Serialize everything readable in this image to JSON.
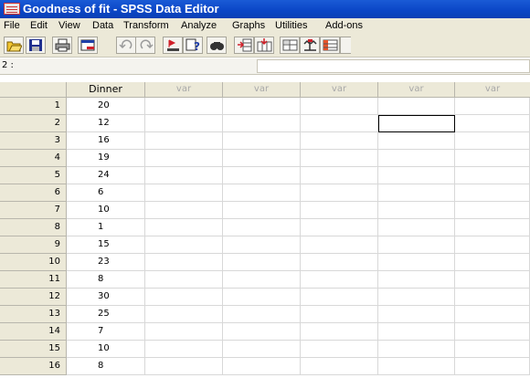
{
  "window": {
    "title": "Goodness of fit - SPSS Data Editor"
  },
  "menu": [
    "File",
    "Edit",
    "View",
    "Data",
    "Transform",
    "Analyze",
    "Graphs",
    "Utilities",
    "Add-ons"
  ],
  "toolbar": {
    "buttons": [
      "open-icon",
      "save-icon",
      "print-icon",
      "dialog-recall-icon",
      "undo-icon",
      "redo-icon",
      "goto-case-icon",
      "variables-icon",
      "find-icon",
      "insert-cases-icon",
      "insert-variable-icon",
      "split-file-icon",
      "weight-cases-icon",
      "select-cases-icon"
    ]
  },
  "cell_editor": {
    "reference": "2 :",
    "value": ""
  },
  "grid": {
    "columns": [
      "Dinner",
      "var",
      "var",
      "var",
      "var",
      "var"
    ],
    "rows": [
      {
        "n": "1",
        "v": "20"
      },
      {
        "n": "2",
        "v": "12"
      },
      {
        "n": "3",
        "v": "16"
      },
      {
        "n": "4",
        "v": "19"
      },
      {
        "n": "5",
        "v": "24"
      },
      {
        "n": "6",
        "v": "6"
      },
      {
        "n": "7",
        "v": "10"
      },
      {
        "n": "8",
        "v": "1"
      },
      {
        "n": "9",
        "v": "15"
      },
      {
        "n": "10",
        "v": "23"
      },
      {
        "n": "11",
        "v": "8"
      },
      {
        "n": "12",
        "v": "30"
      },
      {
        "n": "13",
        "v": "25"
      },
      {
        "n": "14",
        "v": "7"
      },
      {
        "n": "15",
        "v": "10"
      },
      {
        "n": "16",
        "v": "8"
      }
    ],
    "active_cell": {
      "row": 2,
      "column": 5
    }
  }
}
